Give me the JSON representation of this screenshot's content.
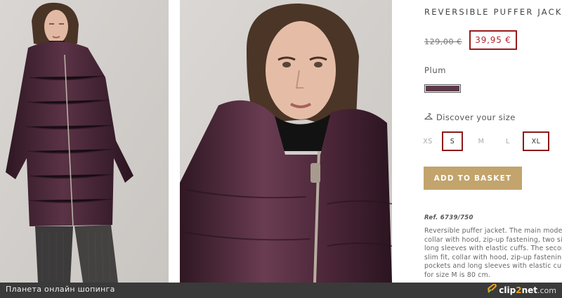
{
  "product": {
    "title": "REVERSIBLE PUFFER JACKET",
    "old_price": "129,00 €",
    "new_price": "39,95 €",
    "color_name": "Plum",
    "swatch_color": "#5a3848",
    "size_guide_label": "Discover your size",
    "sizes": [
      "XS",
      "S",
      "M",
      "L",
      "XL"
    ],
    "add_button": "ADD TO BASKET",
    "ref": "Ref. 6739/750",
    "description_lines": [
      "Reversible puffer jacket. The main model",
      "collar with hood, zip-up fastening, two si",
      "long sleeves with elastic cuffs. The secon",
      "slim fit, collar with hood, zip-up fastening",
      "pockets and long sleeves with elastic cuff",
      "for size M is 80 cm."
    ]
  },
  "footer": {
    "caption": "Планета онлайн шопинга",
    "logo_prefix": "clip",
    "logo_two": "2",
    "logo_net": "net",
    "logo_domain": ".com"
  },
  "colors": {
    "accent_gold": "#c2a46c",
    "highlight_red": "#9b1c1c",
    "jacket_plum": "#4a2838"
  }
}
